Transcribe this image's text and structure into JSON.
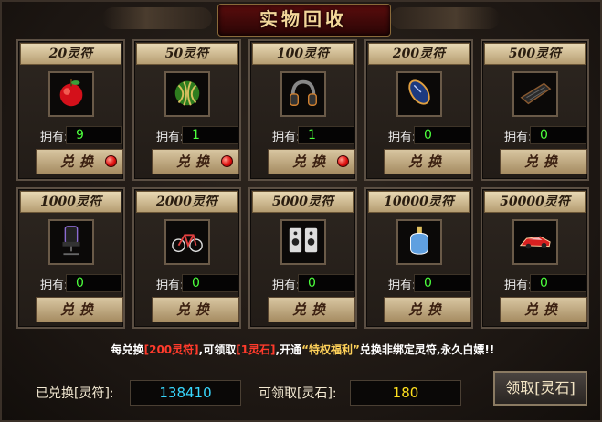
{
  "title": "实物回收",
  "own_prefix": "拥有:",
  "exchange_label": "兑换",
  "items": [
    {
      "cost": "20灵符",
      "owned": "9",
      "icon": "red-apple-icon",
      "has_dot": true
    },
    {
      "cost": "50灵符",
      "owned": "1",
      "icon": "watermelon-icon",
      "has_dot": true
    },
    {
      "cost": "100灵符",
      "owned": "1",
      "icon": "headphones-icon",
      "has_dot": true
    },
    {
      "cost": "200灵符",
      "owned": "0",
      "icon": "mouse-icon",
      "has_dot": false
    },
    {
      "cost": "500灵符",
      "owned": "0",
      "icon": "keyboard-icon",
      "has_dot": false
    },
    {
      "cost": "1000灵符",
      "owned": "0",
      "icon": "gaming-chair-icon",
      "has_dot": false
    },
    {
      "cost": "2000灵符",
      "owned": "0",
      "icon": "bicycle-icon",
      "has_dot": false
    },
    {
      "cost": "5000灵符",
      "owned": "0",
      "icon": "speakers-icon",
      "has_dot": false
    },
    {
      "cost": "10000灵符",
      "owned": "0",
      "icon": "perfume-bottle-icon",
      "has_dot": false
    },
    {
      "cost": "50000灵符",
      "owned": "0",
      "icon": "sports-car-icon",
      "has_dot": false
    }
  ],
  "notice": {
    "p1": "每兑换",
    "p2": "[200灵符]",
    "p3": ",可领取",
    "p4": "[1灵石]",
    "p5": ",开通",
    "p6": "“特权福利”",
    "p7": "兑换非绑定灵符,永久白嫖!!"
  },
  "exchanged_label": "已兑换[灵符]:",
  "exchanged_value": "138410",
  "claimable_label": "可领取[灵石]:",
  "claimable_value": "180",
  "claim_button": "领取[灵石]",
  "colors": {
    "owned_green": "#4cff3c",
    "exchanged_cyan": "#38d8ff",
    "claimable_yellow": "#ffe01e",
    "notice_red": "#ff3b2c"
  }
}
